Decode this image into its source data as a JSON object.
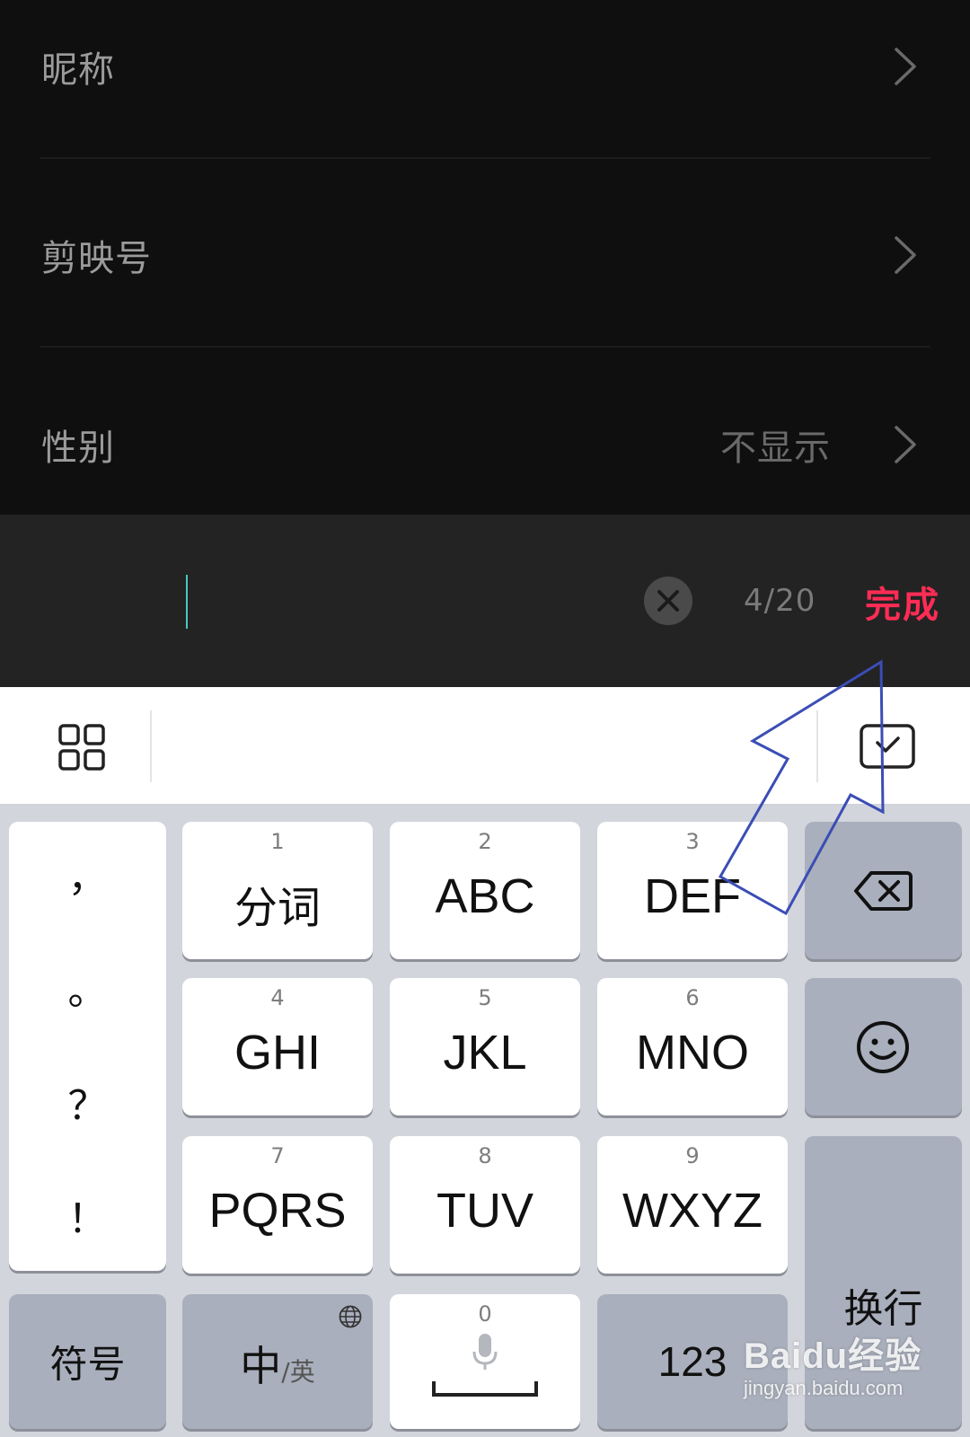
{
  "settings": {
    "rows": [
      {
        "label": "昵称",
        "value": ""
      },
      {
        "label": "剪映号",
        "value": ""
      },
      {
        "label": "性别",
        "value": "不显示"
      }
    ]
  },
  "input_bar": {
    "value": "",
    "counter": "4/20",
    "done_label": "完成",
    "done_color": "#ff2d55"
  },
  "keyboard": {
    "toolbar": {
      "left_icon": "grid-icon",
      "right_icon": "keyboard-hide-icon"
    },
    "punctuation": [
      "，",
      "。",
      "？",
      "！"
    ],
    "keys": [
      {
        "num": "1",
        "letters": "分词"
      },
      {
        "num": "2",
        "letters": "ABC"
      },
      {
        "num": "3",
        "letters": "DEF"
      },
      {
        "num": "4",
        "letters": "GHI"
      },
      {
        "num": "5",
        "letters": "JKL"
      },
      {
        "num": "6",
        "letters": "MNO"
      },
      {
        "num": "7",
        "letters": "PQRS"
      },
      {
        "num": "8",
        "letters": "TUV"
      },
      {
        "num": "9",
        "letters": "WXYZ"
      }
    ],
    "symbol_label": "符号",
    "lang_main": "中",
    "lang_alt": "/英",
    "space_num": "0",
    "num_mode_label": "123",
    "enter_label": "换行"
  },
  "watermark": {
    "logo": "Baidu经验",
    "url": "jingyan.baidu.com"
  }
}
